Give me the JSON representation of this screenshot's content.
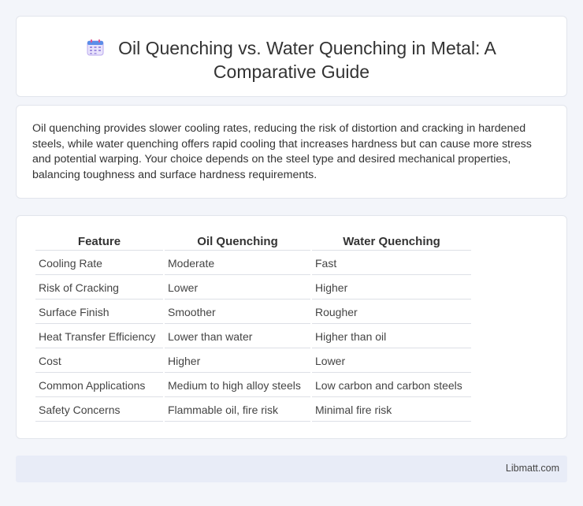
{
  "header": {
    "icon": "calendar-icon",
    "title": "Oil Quenching vs. Water Quenching in Metal: A Comparative Guide"
  },
  "summary": {
    "text": "Oil quenching provides slower cooling rates, reducing the risk of distortion and cracking in hardened steels, while water quenching offers rapid cooling that increases hardness but can cause more stress and potential warping. Your choice depends on the steel type and desired mechanical properties, balancing toughness and surface hardness requirements."
  },
  "table": {
    "headers": [
      "Feature",
      "Oil Quenching",
      "Water Quenching"
    ],
    "rows": [
      [
        "Cooling Rate",
        "Moderate",
        "Fast"
      ],
      [
        "Risk of Cracking",
        "Lower",
        "Higher"
      ],
      [
        "Surface Finish",
        "Smoother",
        "Rougher"
      ],
      [
        "Heat Transfer Efficiency",
        "Lower than water",
        "Higher than oil"
      ],
      [
        "Cost",
        "Higher",
        "Lower"
      ],
      [
        "Common Applications",
        "Medium to high alloy steels",
        "Low carbon and carbon steels"
      ],
      [
        "Safety Concerns",
        "Flammable oil, fire risk",
        "Minimal fire risk"
      ]
    ]
  },
  "footer": {
    "source": "Libmatt.com"
  }
}
